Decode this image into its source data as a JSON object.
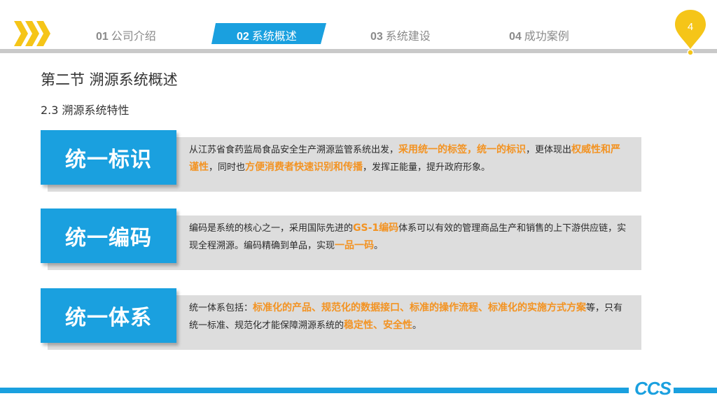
{
  "colors": {
    "accent": "#1aa0df",
    "highlight": "#f39322",
    "pin": "#f5c518",
    "chevron": "#f5c518"
  },
  "nav": {
    "items": [
      {
        "num": "01",
        "label": "公司介绍",
        "active": false
      },
      {
        "num": "02",
        "label": "系统概述",
        "active": true
      },
      {
        "num": "03",
        "label": "系统建设",
        "active": false
      },
      {
        "num": "04",
        "label": "成功案例",
        "active": false
      }
    ]
  },
  "page_number": "4",
  "section_title": "第二节 溯源系统概述",
  "subsection": "2.3  溯源系统特性",
  "cards": [
    {
      "title": "统一标识",
      "desc": [
        {
          "t": "从江苏省食药监局食品安全生产溯源监管系统出发，",
          "h": false
        },
        {
          "t": "采用统一的标签，统一的标识",
          "h": true
        },
        {
          "t": "，更体现出",
          "h": false
        },
        {
          "t": "权威性和严谨性",
          "h": true
        },
        {
          "t": "，同时也",
          "h": false
        },
        {
          "t": "方便消费者快速识别和传播",
          "h": true
        },
        {
          "t": "，发挥正能量，提升政府形象。",
          "h": false
        }
      ]
    },
    {
      "title": "统一编码",
      "desc": [
        {
          "t": "编码是系统的核心之一，采用国际先进的",
          "h": false
        },
        {
          "t": "GS-1编码",
          "h": true
        },
        {
          "t": "体系可以有效的管理商品生产和销售的上下游供应链，实现全程溯源。编码精确到单品，实现",
          "h": false
        },
        {
          "t": "一品一码",
          "h": true
        },
        {
          "t": "。",
          "h": false
        }
      ]
    },
    {
      "title": "统一体系",
      "desc": [
        {
          "t": "统一体系包括：",
          "h": false
        },
        {
          "t": "标准化的产品、规范化的数据接口、标准的操作流程、标准化的实施方式方案",
          "h": true
        },
        {
          "t": "等，只有统一标准、规范化才能保障溯源系统的",
          "h": false
        },
        {
          "t": "稳定性、安全性",
          "h": true
        },
        {
          "t": "。",
          "h": false
        }
      ]
    }
  ],
  "logo": "CCS"
}
